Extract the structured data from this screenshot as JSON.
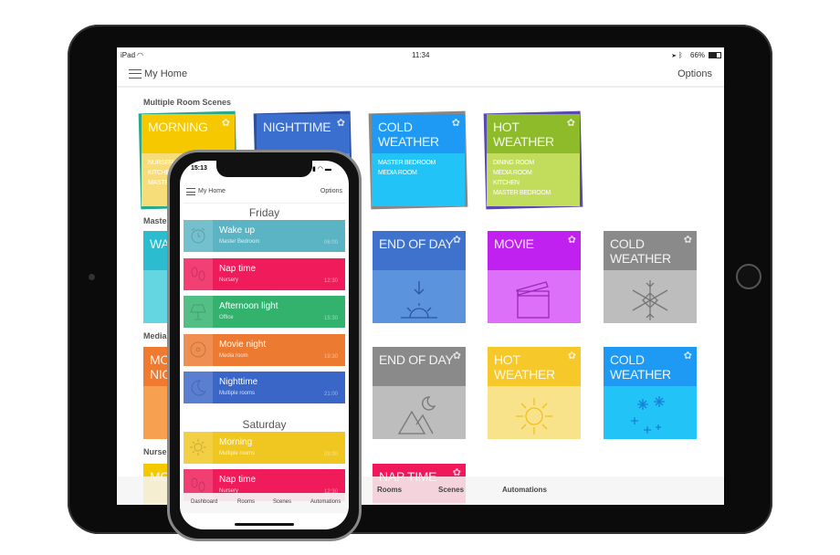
{
  "ipad": {
    "status": {
      "device": "iPad",
      "time": "11:34",
      "battery": "66%"
    },
    "nav": {
      "title": "My Home",
      "options": "Options"
    },
    "sections": {
      "multi": "Multiple Room Scenes",
      "master": "Maste",
      "media": "Media",
      "nursery": "Nurser"
    },
    "multi_tiles": [
      {
        "title": "MORNING",
        "rooms": "NURSERY\nKITCHEN\nMASTER",
        "color": "#f5c800",
        "light": "#f7dc7a"
      },
      {
        "title": "NIGHTTIME",
        "rooms": "",
        "color": "#3a6fd0",
        "light": "#5b8ee0"
      },
      {
        "title": "COLD\nWEATHER",
        "rooms": "MASTER BEDROOM\nMEDIA ROOM",
        "color": "#1e9af5",
        "light": "#22c4f7"
      },
      {
        "title": "HOT\nWEATHER",
        "rooms": "DINING ROOM\nMEDIA ROOM\nKITCHEN\nMASTER BEDROOM",
        "color": "#8dbb2a",
        "light": "#c2dc5c"
      }
    ],
    "left_tiles": [
      {
        "title": "WA",
        "color": "#2bbcd0",
        "light": "#64d6e2"
      },
      {
        "title": "MO\nNIG",
        "color": "#f07a30",
        "light": "#f7a050"
      },
      {
        "title": "MO",
        "color": "#f5c800",
        "light": "#f7dc7a"
      }
    ],
    "grid_tiles": [
      {
        "title": "END OF DAY",
        "icon": "sunset-icon",
        "color": "#3e72cc",
        "light": "#5b93dd"
      },
      {
        "title": "MOVIE",
        "icon": "clapperboard-icon",
        "color": "#c020f0",
        "light": "#dd70f8"
      },
      {
        "title": "COLD\nWEATHER",
        "icon": "snowflake-icon",
        "color": "#8a8a8a",
        "light": "#bdbdbd"
      },
      {
        "title": "END OF DAY",
        "icon": "moon-mountain-icon",
        "color": "#8a8a8a",
        "light": "#bdbdbd"
      },
      {
        "title": "HOT\nWEATHER",
        "icon": "sun-icon",
        "color": "#f7c82a",
        "light": "#f9e38a"
      },
      {
        "title": "COLD\nWEATHER",
        "icon": "snowflakes-icon",
        "color": "#1e9af5",
        "light": "#22c4f7"
      },
      {
        "title": "NAP TIME",
        "icon": "",
        "color": "#f0185a",
        "light": "#f7b8cc"
      }
    ],
    "tabs": [
      "Rooms",
      "Scenes",
      "Automations"
    ]
  },
  "iphone": {
    "status": {
      "time": "15:13"
    },
    "nav": {
      "title": "My Home",
      "options": "Options"
    },
    "days": [
      {
        "label": "Friday",
        "items": [
          {
            "name": "Wake up",
            "room": "Master Bedroom",
            "time": "06:00",
            "color": "#5ab4c4",
            "icon": "alarm-clock-icon"
          },
          {
            "name": "Nap time",
            "room": "Nursery",
            "time": "12:30",
            "color": "#ef1b5a",
            "icon": "footprints-icon"
          },
          {
            "name": "Afternoon light",
            "room": "Office",
            "time": "15:30",
            "color": "#33b26e",
            "icon": "lamp-icon"
          },
          {
            "name": "Movie night",
            "room": "Media room",
            "time": "19:30",
            "color": "#ec7a30",
            "icon": "film-reel-icon"
          },
          {
            "name": "Nighttime",
            "room": "Multiple rooms",
            "time": "21:00",
            "color": "#3a66c8",
            "icon": "moon-icon"
          }
        ]
      },
      {
        "label": "Saturday",
        "items": [
          {
            "name": "Morning",
            "room": "Multiple rooms",
            "time": "09:30",
            "color": "#f0c620",
            "icon": "sun-icon"
          },
          {
            "name": "Nap time",
            "room": "Nursery",
            "time": "12:30",
            "color": "#ef1b5a",
            "icon": "footprints-icon"
          }
        ]
      }
    ],
    "tabs": [
      "Dashboard",
      "Rooms",
      "Scenes",
      "Automations"
    ]
  }
}
